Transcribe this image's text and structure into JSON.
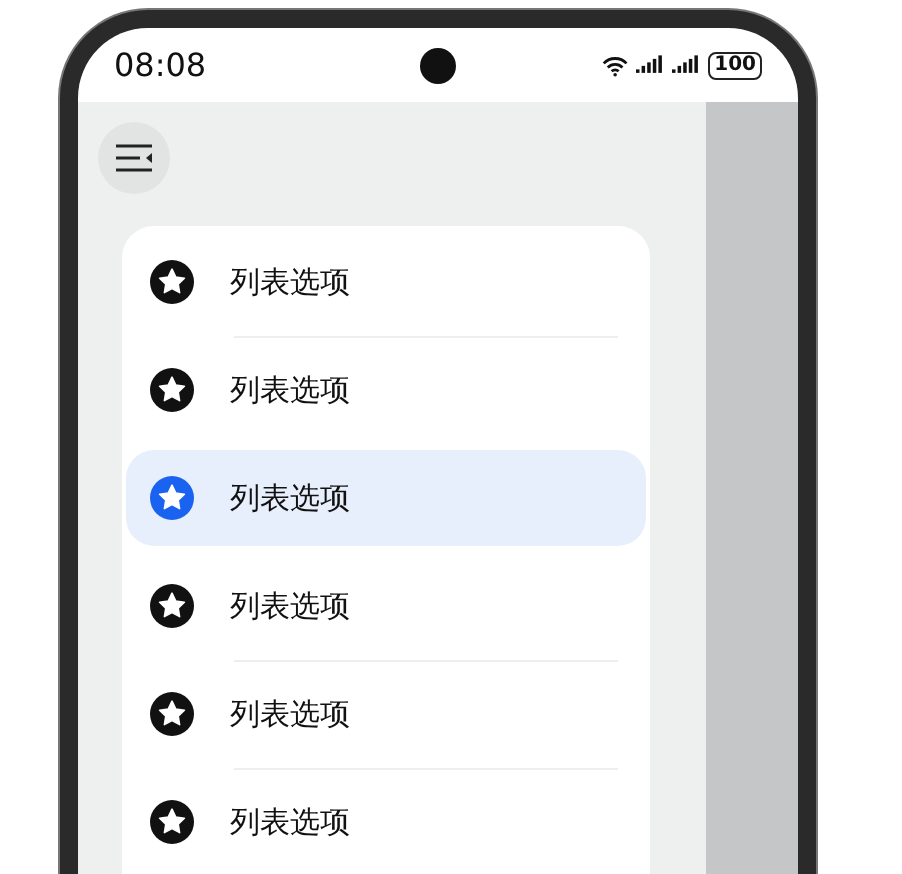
{
  "status_bar": {
    "time": "08:08",
    "battery": "100"
  },
  "list": {
    "items": [
      {
        "label": "列表选项",
        "selected": false
      },
      {
        "label": "列表选项",
        "selected": false
      },
      {
        "label": "列表选项",
        "selected": true
      },
      {
        "label": "列表选项",
        "selected": false
      },
      {
        "label": "列表选项",
        "selected": false
      },
      {
        "label": "列表选项",
        "selected": false
      }
    ]
  }
}
